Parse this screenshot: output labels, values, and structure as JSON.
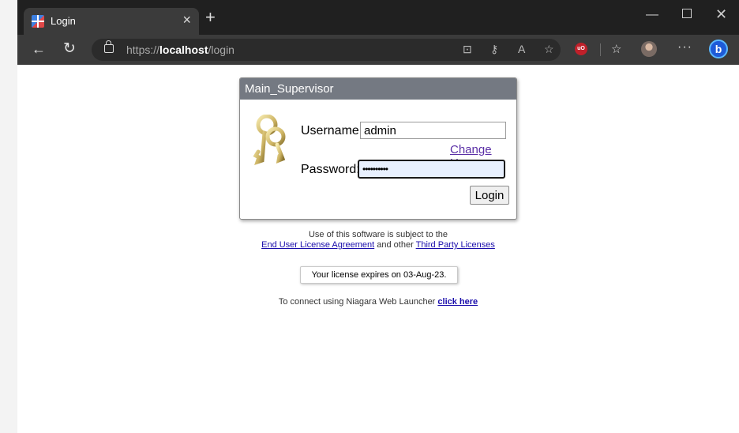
{
  "browser": {
    "tab_title": "Login",
    "tab_close_glyph": "×",
    "new_tab_glyph": "+",
    "url_prefix": "https://",
    "url_host": "localhost",
    "url_path": "/login",
    "window_controls": {
      "minimize": "—",
      "close": "✕"
    },
    "toolbar_icons": [
      "back-icon",
      "refresh-icon",
      "lock-icon",
      "app-available-icon",
      "password-key-icon",
      "read-aloud-icon",
      "add-favorite-icon",
      "ublock-icon",
      "favorites-icon",
      "profile-avatar",
      "more-icon",
      "bing-icon"
    ],
    "ublock_label": "uO"
  },
  "login": {
    "title": "Main_Supervisor",
    "username_label": "Username:",
    "username_value": "admin",
    "change_user_link": "Change User",
    "password_label": "Password:",
    "password_masked": "••••••••••",
    "login_button": "Login"
  },
  "footer": {
    "eula_line1": "Use of this software is subject to the",
    "eula_link": "End User License Agreement",
    "eula_and": " and other ",
    "third_party_link": "Third Party Licenses",
    "license_expiry": "Your license expires on 03-Aug-23.",
    "launcher_text": "To connect using Niagara Web Launcher ",
    "launcher_link": "click here"
  },
  "colors": {
    "titlebar": "#202020",
    "toolbar": "#3b3b3b",
    "login_header": "#747982",
    "visited_link": "#5a2ea6",
    "link": "#1a0dab",
    "password_fill": "#e8f0fe"
  }
}
